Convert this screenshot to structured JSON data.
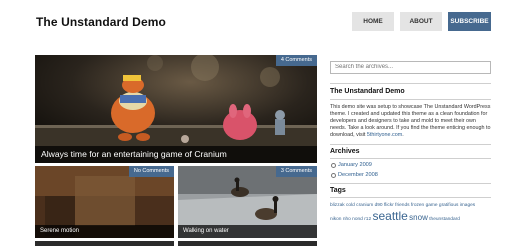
{
  "site": {
    "title": "The Unstandard Demo"
  },
  "nav": {
    "home": "HOME",
    "about": "ABOUT",
    "subscribe": "SUBSCRIBE"
  },
  "posts": {
    "featured": {
      "title": "Always time for an entertaining game of Cranium",
      "comments": "4 Comments"
    },
    "items": [
      {
        "title": "Serene motion",
        "comments": "No Comments"
      },
      {
        "title": "Walking on water",
        "comments": "3 Comments"
      }
    ]
  },
  "sidebar": {
    "search_placeholder": "Search the archives...",
    "about": {
      "title": "The Unstandard Demo",
      "text": "This demo site was setup to showcase The Unstandard WordPress theme. I created and updated this theme as a clean foundation for developers and designers to take and mold to meet their own needs. Take a look around. If you find the theme enticing enough to download, visit",
      "link": "5thirtyone.com",
      "after_link": "."
    },
    "archives": {
      "title": "Archives",
      "items": [
        "January 2009",
        "December 2008"
      ]
    },
    "tags": {
      "title": "Tags",
      "row1": [
        "blizzak",
        "cold",
        "cranium",
        "d90",
        "flickr",
        "friends",
        "frozen",
        "game",
        "gratifious",
        "images"
      ],
      "row2_a": [
        "nikon",
        "nho",
        "nond",
        "r12"
      ],
      "row2_big": "seattle",
      "row2_med": "snow",
      "row2_b": [
        "the",
        "unstandard"
      ]
    }
  }
}
